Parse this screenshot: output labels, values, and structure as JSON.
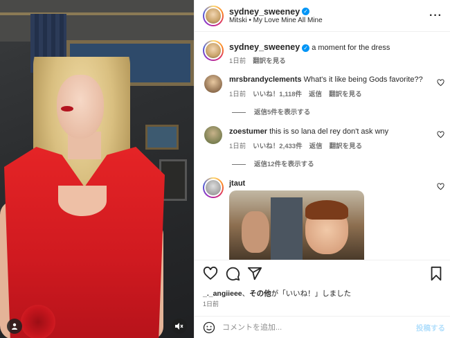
{
  "post_author": {
    "username": "sydney_sweeney",
    "subtitle": "Mitski • My Love Mine All Mine"
  },
  "caption": {
    "username": "sydney_sweeney",
    "text": "a moment for the dress",
    "time": "1日前",
    "translate": "翻訳を見る"
  },
  "comments": [
    {
      "username": "mrsbrandyclements",
      "text": "What's it like being Gods favorite??",
      "time": "1日前",
      "likes": "いいね！1,118件",
      "reply": "返信",
      "translate": "翻訳を見る",
      "view_replies": "返信5件を表示する"
    },
    {
      "username": "zoestumer",
      "text": "this is so lana del rey don't ask wny",
      "time": "1日前",
      "likes": "いいね！2,433件",
      "reply": "返信",
      "translate": "翻訳を見る",
      "view_replies": "返信12件を表示する"
    },
    {
      "username": "jtaut"
    }
  ],
  "liked_by": {
    "user": "_._angiieee",
    "sep": "、",
    "others": "その他",
    "suffix": "が「いいね！」しました"
  },
  "post_date": "1日前",
  "comment_box": {
    "placeholder": "コメントを追加...",
    "post_label": "投稿する"
  },
  "icons": {
    "more": "more-options-icon",
    "like": "heart-icon",
    "comment": "comment-icon",
    "share": "share-icon",
    "save": "bookmark-icon",
    "emoji": "emoji-icon",
    "mute": "speaker-muted-icon",
    "tags": "user-tag-icon"
  },
  "colors": {
    "verified": "#0095f6",
    "post_button_disabled": "#b2dffc",
    "dress": "#e52426"
  }
}
